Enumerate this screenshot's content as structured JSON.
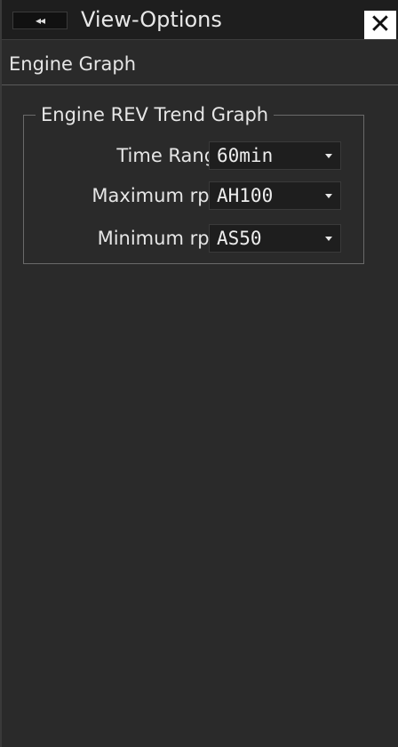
{
  "titlebar": {
    "collapse_glyph": "◂◂",
    "title": "View-Options",
    "close_glyph": "✕"
  },
  "subheader": {
    "title": "Engine Graph"
  },
  "group": {
    "legend": "Engine REV Trend Graph",
    "rows": [
      {
        "label": "Time Range",
        "value": "60min"
      },
      {
        "label": "Maximum rpm",
        "value": "AH100"
      },
      {
        "label": "Minimum rpm",
        "value": "AS50"
      }
    ]
  }
}
